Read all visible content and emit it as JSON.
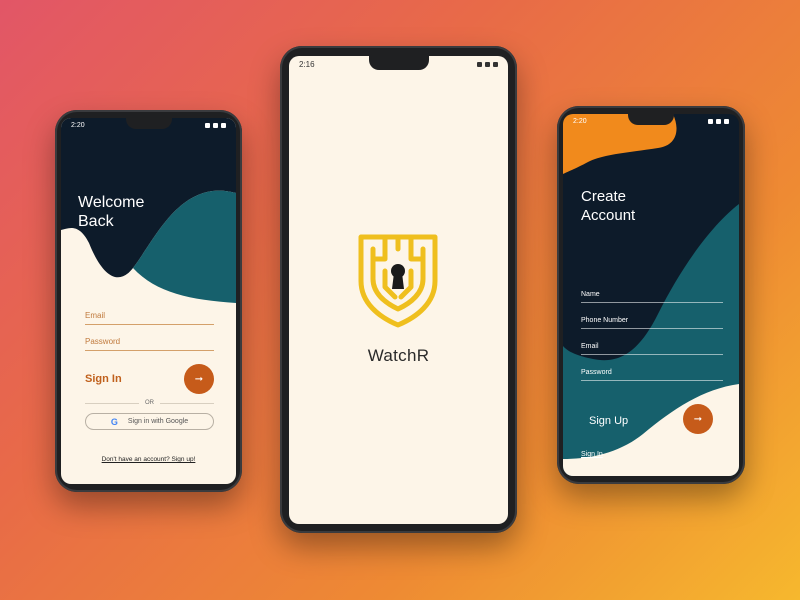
{
  "colors": {
    "accent": "#c65b1a",
    "dark_navy": "#0d1b2a",
    "teal": "#16606c",
    "cream": "#fdf5e8",
    "logo_gold": "#efbf1e",
    "orange_blob": "#f18a1c"
  },
  "left_screen": {
    "status_time": "2:20",
    "title": "Welcome\nBack",
    "email_label": "Email",
    "password_label": "Password",
    "signin_label": "Sign In",
    "submit_icon": "arrow-right-icon",
    "or_text": "OR",
    "google_icon": "google-icon",
    "google_label": "Sign in with Google",
    "signup_prompt": "Don't have an account? Sign up!"
  },
  "center_screen": {
    "status_time": "2:16",
    "logo_icon": "shield-keyhole-circuit-icon",
    "app_name": "WatchR"
  },
  "right_screen": {
    "status_time": "2:20",
    "title": "Create\nAccount",
    "fields": [
      {
        "label": "Name"
      },
      {
        "label": "Phone Number"
      },
      {
        "label": "Email"
      },
      {
        "label": "Password"
      }
    ],
    "signup_label": "Sign Up",
    "submit_icon": "arrow-right-icon",
    "signin_link": "Sign In"
  }
}
